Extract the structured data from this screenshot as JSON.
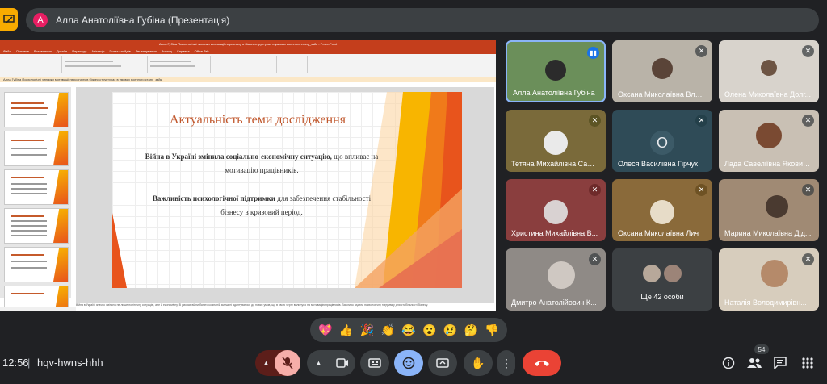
{
  "header": {
    "presenter_initial": "А",
    "presenter_title": "Алла Анатоліївна Губіна (Презентація)"
  },
  "presentation": {
    "window_title": "Алла Губіна Психологічні чинники мотивації персоналу в бізнес-структурах в умовах воєнного стану_зайк - PowerPoint",
    "tabs": [
      "Файл",
      "Основне",
      "Вставлення",
      "Дизайн",
      "Переходи",
      "Анімація",
      "Показ слайдів",
      "Рецензування",
      "Вигляд",
      "Справка",
      "Office Tab"
    ],
    "doc_tab": "Алла Губіна Психологічні чинники мотивації персоналу в бізнес-структурах в умовах воєнного стану_зайк",
    "slide_title": "Актуальність теми дослідження",
    "p1_bold": "Війна в Україні змінила соціально-економічну ситуацію,",
    "p1_rest": " що впливає на мотивацію працівників.",
    "p2_bold": "Важливість психологічної підтримки",
    "p2_rest": " для забезпечення стабільності бізнесу в кризовий період.",
    "notes": "Війна в Україні значно змінила не лише політичну ситуацію, але й економічну. В умовах війни багато компаній змушені адаптуватися до нових умов, що в свою чергу вплинуло на мотивацію працівників. Важливо надати психологічну підтримку для стабільності бізнесу."
  },
  "participants": [
    {
      "name": "Алла Анатоліївна Губіна",
      "mic": "speaking"
    },
    {
      "name": "Оксана Миколаївна Вла...",
      "mic": "muted"
    },
    {
      "name": "Олена Миколаївна Долг...",
      "mic": "muted"
    },
    {
      "name": "Тетяна Михайлівна Савич",
      "mic": "muted"
    },
    {
      "name": "Олеся Василівна Гірчук",
      "mic": "muted",
      "initial": "О"
    },
    {
      "name": "Лада Савеліївна Яковиц...",
      "mic": "muted"
    },
    {
      "name": "Христина Михайлівна В...",
      "mic": "muted"
    },
    {
      "name": "Оксана Миколаївна Лич",
      "mic": "muted"
    },
    {
      "name": "Марина Миколаївна Дід...",
      "mic": "muted"
    },
    {
      "name": "Дмитро Анатолійович К...",
      "mic": "muted"
    },
    {
      "name": "Ще 42 особи",
      "mic": "none"
    },
    {
      "name": "Наталія Володимирівн...",
      "mic": "muted"
    }
  ],
  "reactions": [
    "💖",
    "👍",
    "🎉",
    "👏",
    "😂",
    "😮",
    "😢",
    "🤔",
    "👎"
  ],
  "footer": {
    "time": "12:56",
    "separator": "|",
    "meeting_code": "hqv-hwns-hhh",
    "participant_count": "54"
  },
  "colors": {
    "accent_blue": "#8ab4f8",
    "end_call_red": "#ea4335",
    "mic_off_pink": "#f6aea9",
    "present_yellow": "#f9ab00"
  }
}
